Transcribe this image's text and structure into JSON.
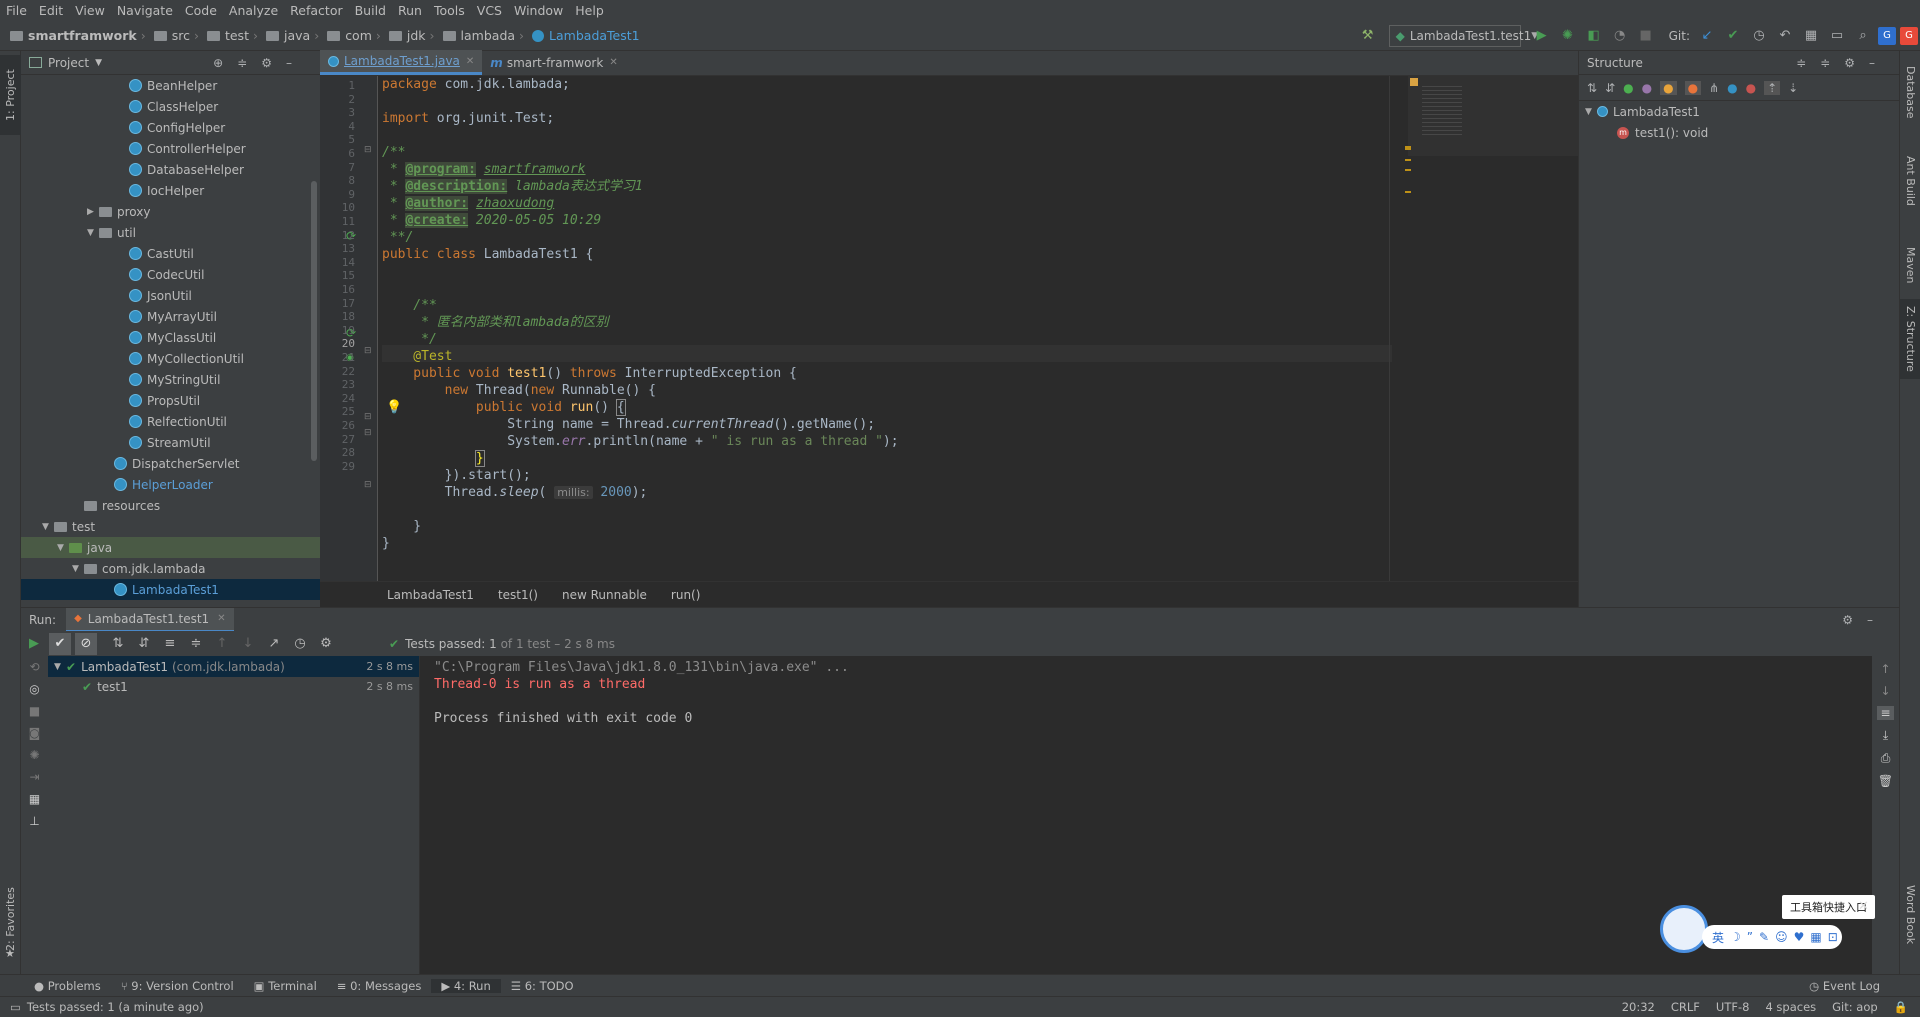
{
  "menu": [
    "File",
    "Edit",
    "View",
    "Navigate",
    "Code",
    "Analyze",
    "Refactor",
    "Build",
    "Run",
    "Tools",
    "VCS",
    "Window",
    "Help"
  ],
  "breadcrumb": [
    "smartframwork",
    "src",
    "test",
    "java",
    "com",
    "jdk",
    "lambada",
    "LambadaTest1"
  ],
  "run_config": "LambadaTest1.test1",
  "git_label": "Git:",
  "left_strip": {
    "project": "1: Project",
    "favorites": "2: Favorites"
  },
  "right_strip": {
    "database": "Database",
    "ant": "Ant Build",
    "maven": "Maven",
    "structure": "Z: Structure",
    "word": "Word Book"
  },
  "project_panel": {
    "title": "Project",
    "items": [
      {
        "label": "BeanHelper",
        "indent": 6,
        "type": "class"
      },
      {
        "label": "ClassHelper",
        "indent": 6,
        "type": "class"
      },
      {
        "label": "ConfigHelper",
        "indent": 6,
        "type": "class"
      },
      {
        "label": "ControllerHelper",
        "indent": 6,
        "type": "class"
      },
      {
        "label": "DatabaseHelper",
        "indent": 6,
        "type": "class"
      },
      {
        "label": "IocHelper",
        "indent": 6,
        "type": "class"
      },
      {
        "label": "proxy",
        "indent": 4,
        "type": "folder",
        "arrow": "▶"
      },
      {
        "label": "util",
        "indent": 4,
        "type": "folder",
        "arrow": "▼"
      },
      {
        "label": "CastUtil",
        "indent": 6,
        "type": "class"
      },
      {
        "label": "CodecUtil",
        "indent": 6,
        "type": "class"
      },
      {
        "label": "JsonUtil",
        "indent": 6,
        "type": "class"
      },
      {
        "label": "MyArrayUtil",
        "indent": 6,
        "type": "class"
      },
      {
        "label": "MyClassUtil",
        "indent": 6,
        "type": "class"
      },
      {
        "label": "MyCollectionUtil",
        "indent": 6,
        "type": "class"
      },
      {
        "label": "MyStringUtil",
        "indent": 6,
        "type": "class"
      },
      {
        "label": "PropsUtil",
        "indent": 6,
        "type": "class"
      },
      {
        "label": "RelfectionUtil",
        "indent": 6,
        "type": "class"
      },
      {
        "label": "StreamUtil",
        "indent": 6,
        "type": "class"
      },
      {
        "label": "DispatcherServlet",
        "indent": 5,
        "type": "class"
      },
      {
        "label": "HelperLoader",
        "indent": 5,
        "type": "class",
        "blue": true
      },
      {
        "label": "resources",
        "indent": 3,
        "type": "folder"
      },
      {
        "label": "test",
        "indent": 1,
        "type": "folder",
        "arrow": "▼"
      },
      {
        "label": "java",
        "indent": 2,
        "type": "folder",
        "arrow": "▼",
        "hl": true
      },
      {
        "label": "com.jdk.lambada",
        "indent": 3,
        "type": "folder",
        "arrow": "▼"
      },
      {
        "label": "LambadaTest1",
        "indent": 5,
        "type": "class",
        "sel": true,
        "blue": true
      }
    ]
  },
  "editor": {
    "tabs": [
      "LambadaTest1.java",
      "smart-framwork"
    ],
    "line_count": 29,
    "breadcrumb": [
      "LambadaTest1",
      "test1()",
      "new Runnable",
      "run()"
    ],
    "hint_millis": "millis:"
  },
  "structure": {
    "title": "Structure",
    "root": "LambadaTest1",
    "child": "test1(): void"
  },
  "run": {
    "label": "Run:",
    "tab": "LambadaTest1.test1",
    "summary_prefix": "Tests passed:",
    "summary_count": "1",
    "summary_rest": "of 1 test – 2 s 8 ms",
    "tree": [
      {
        "label": "LambadaTest1",
        "pkg": "(com.jdk.lambada)",
        "time": "2 s 8 ms"
      },
      {
        "label": "test1",
        "time": "2 s 8 ms"
      }
    ],
    "console": [
      "\"C:\\Program Files\\Java\\jdk1.8.0_131\\bin\\java.exe\" ...",
      "Thread-0 is run as a thread",
      "",
      "Process finished with exit code 0"
    ]
  },
  "bottom_tabs": [
    "Problems",
    "9: Version Control",
    "Terminal",
    "0: Messages",
    "4: Run",
    "6: TODO"
  ],
  "event_log": "Event Log",
  "status": {
    "left": "Tests passed: 1 (a minute ago)",
    "pos": "20:32",
    "crlf": "CRLF",
    "enc": "UTF-8",
    "indent": "4 spaces",
    "git": "Git: aop"
  },
  "ime": {
    "tooltip": "工具箱快捷入口",
    "lang": "英"
  }
}
